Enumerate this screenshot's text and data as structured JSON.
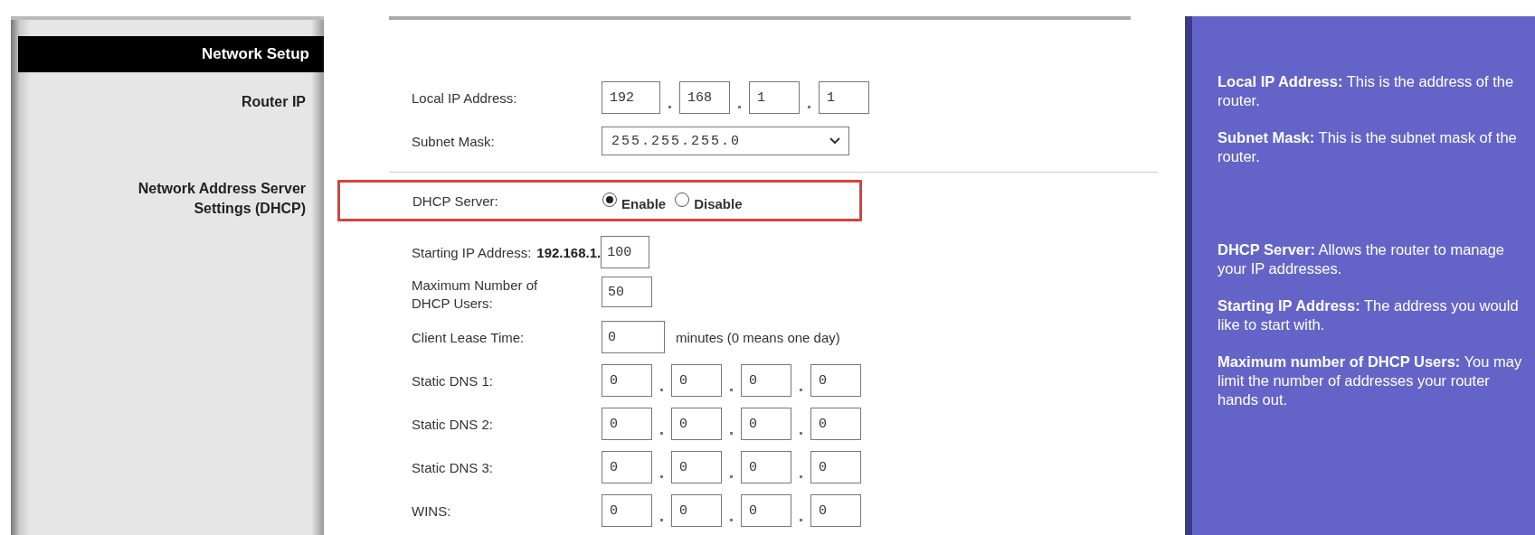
{
  "sidebar": {
    "header": "Network Setup",
    "sections": [
      {
        "label": "Router IP"
      },
      {
        "label": "Network Address Server Settings (DHCP)"
      }
    ]
  },
  "router_ip": {
    "local_ip": {
      "label": "Local IP Address:",
      "octets": [
        "192",
        "168",
        "1",
        "1"
      ]
    },
    "subnet_mask": {
      "label": "Subnet Mask:",
      "value": "255.255.255.0"
    }
  },
  "dhcp": {
    "server": {
      "label": "DHCP Server:",
      "highlighted": true,
      "options": [
        {
          "label": "Enable",
          "selected": true
        },
        {
          "label": "Disable",
          "selected": false
        }
      ]
    },
    "starting_ip": {
      "label": "Starting IP Address:",
      "prefix": "192.168.1.",
      "value": "100"
    },
    "max_users": {
      "label": "Maximum Number of DHCP Users:",
      "value": "50"
    },
    "lease_time": {
      "label": "Client Lease Time:",
      "value": "0",
      "unit": "minutes (0 means one day)"
    },
    "ip_rows": [
      {
        "label": "Static DNS 1:",
        "octets": [
          "0",
          "0",
          "0",
          "0"
        ]
      },
      {
        "label": "Static DNS 2:",
        "octets": [
          "0",
          "0",
          "0",
          "0"
        ]
      },
      {
        "label": "Static DNS 3:",
        "octets": [
          "0",
          "0",
          "0",
          "0"
        ]
      },
      {
        "label": "WINS:",
        "octets": [
          "0",
          "0",
          "0",
          "0"
        ]
      }
    ]
  },
  "help": [
    "**Local IP Address:** This is the address of the router.",
    "**Subnet Mask:** This is the subnet mask of the router.",
    "**DHCP Server:** Allows the router to manage your IP addresses.",
    "**Starting IP Address:** The address you would like to start with.",
    "**Maximum number of DHCP Users:** You may limit the number of addresses your router hands out."
  ]
}
